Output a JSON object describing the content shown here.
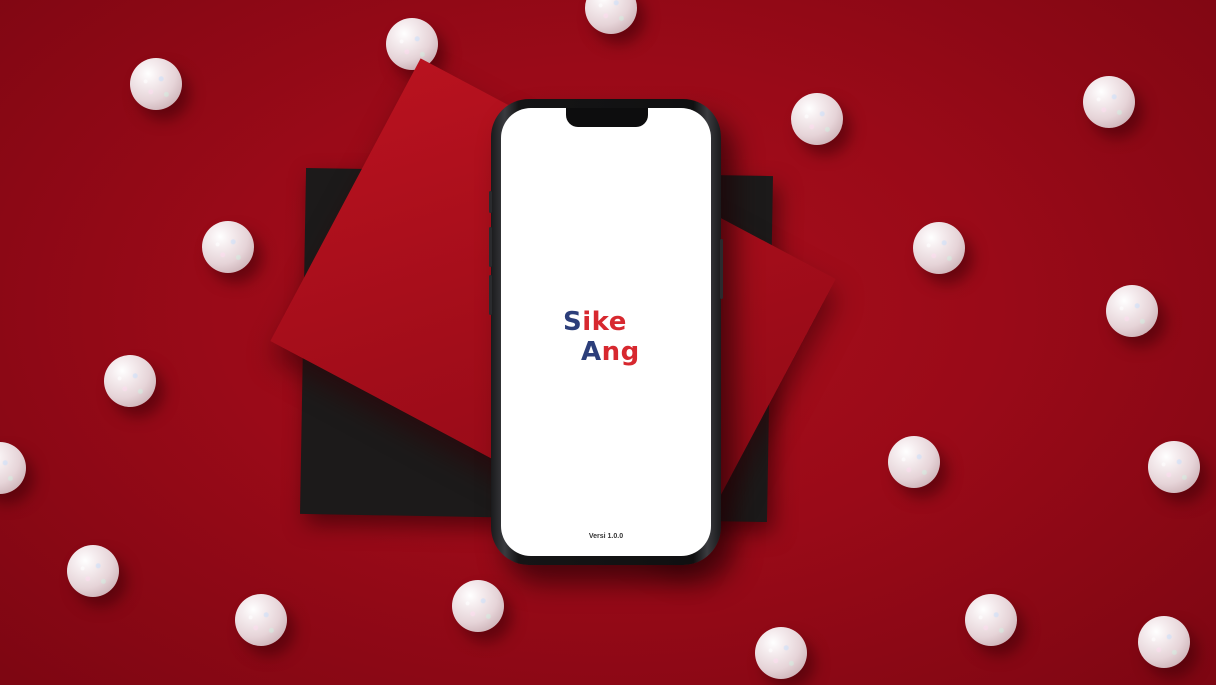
{
  "app": {
    "logo_part1_line1": "S",
    "logo_part2_line1": "ike",
    "logo_part1_line2": "A",
    "logo_part2_line2": "ng",
    "version": "Versi 1.0.0"
  },
  "colors": {
    "background": "#9a0a18",
    "logo_blue": "#2c3e7a",
    "logo_red": "#d7282f",
    "screen": "#ffffff"
  }
}
